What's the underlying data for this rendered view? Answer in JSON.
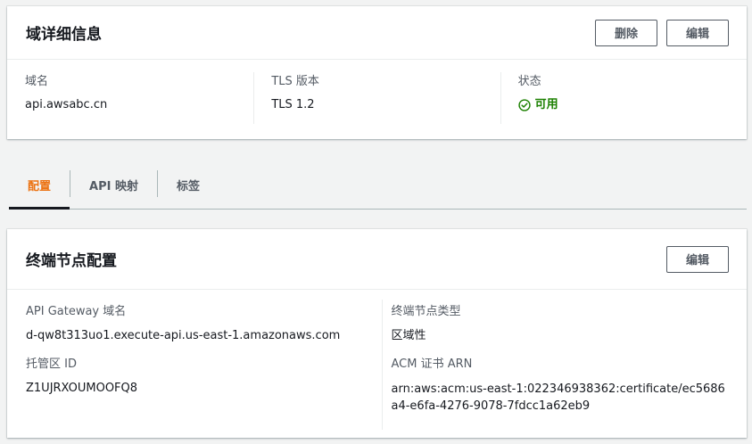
{
  "domain_panel": {
    "title": "域详细信息",
    "delete_label": "删除",
    "edit_label": "编辑",
    "fields": [
      {
        "label": "域名",
        "value": "api.awsabc.cn"
      },
      {
        "label": "TLS 版本",
        "value": "TLS 1.2"
      },
      {
        "label": "状态",
        "value": "可用",
        "status_color": "#1d8102",
        "icon": "check-circle-icon"
      }
    ]
  },
  "tabs": [
    {
      "label": "配置",
      "active": true
    },
    {
      "label": "API 映射",
      "active": false
    },
    {
      "label": "标签",
      "active": false
    }
  ],
  "endpoint_panel": {
    "title": "终端节点配置",
    "edit_label": "编辑",
    "left_fields": [
      {
        "label": "API Gateway 域名",
        "value": "d-qw8t313uo1.execute-api.us-east-1.amazonaws.com"
      },
      {
        "label": "托管区 ID",
        "value": "Z1UJRXOUMOOFQ8"
      }
    ],
    "right_fields": [
      {
        "label": "终端节点类型",
        "value": "区域性"
      },
      {
        "label": "ACM 证书 ARN",
        "value": "arn:aws:acm:us-east-1:022346938362:certificate/ec5686a4-e6fa-4276-9078-7fdcc1a62eb9"
      }
    ]
  },
  "colors": {
    "accent_tab": "#ec7211",
    "status_ok": "#1d8102",
    "background": "#f2f3f3"
  }
}
